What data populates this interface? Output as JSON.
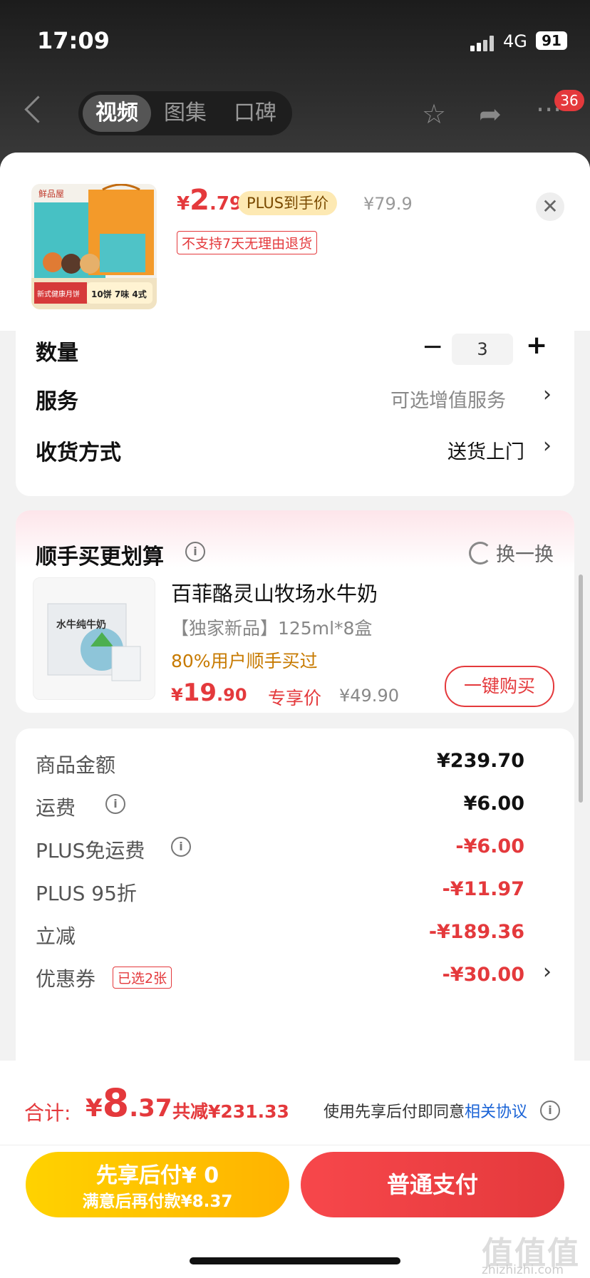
{
  "status": {
    "time": "17:09",
    "network": "4G",
    "battery": "91"
  },
  "nav": {
    "tabs": [
      "视频",
      "图集",
      "口碑"
    ],
    "badge": "36"
  },
  "product": {
    "price_yen": "¥",
    "price_int": "2",
    "price_dec": ".79",
    "plus_tag": "PLUS到手价",
    "original_price": "¥79.9",
    "no_return": "不支持7天无理由退货",
    "thumb_brand": "鲜品屋",
    "thumb_label": "新式健康月饼",
    "thumb_badge": "10饼 7味 4式"
  },
  "options": {
    "quantity_label": "数量",
    "quantity_value": "3",
    "service_label": "服务",
    "service_value": "可选增值服务",
    "delivery_label": "收货方式",
    "delivery_value": "送货上门"
  },
  "recommend": {
    "title": "顺手买更划算",
    "swap_label": "换一换",
    "name": "百菲酪灵山牧场水牛奶",
    "spec": "【独家新品】125ml*8盒",
    "buyers": "80%用户顺手买过",
    "price_yen": "¥",
    "price_int": "19",
    "price_dec": ".90",
    "price_tag": "专享价",
    "original_price": "¥49.90",
    "buy_label": "一键购买",
    "thumb_text": "水牛纯牛奶"
  },
  "fees": {
    "goods_label": "商品金额",
    "goods_value": "¥239.70",
    "shipping_label": "运费",
    "shipping_value": "¥6.00",
    "plus_free_label": "PLUS免运费",
    "plus_free_value": "-¥6.00",
    "plus_discount_label": "PLUS 95折",
    "plus_discount_value": "-¥11.97",
    "instant_label": "立减",
    "instant_value": "-¥189.36",
    "coupon_label": "优惠券",
    "coupon_tag": "已选2张",
    "coupon_value": "-¥30.00"
  },
  "footer": {
    "total_label": "合计:",
    "total_yen": "¥",
    "total_int": "8",
    "total_dec": ".37",
    "saved": "共减¥231.33",
    "agree_text": "使用先享后付即同意",
    "agree_link": "相关协议",
    "later_line1": "先享后付¥ 0",
    "later_line2": "满意后再付款¥8.37",
    "pay_label": "普通支付",
    "watermark": "值值值",
    "watermark_url": "zhizhizhi.com"
  },
  "colors": {
    "accent": "#e4393c",
    "gold": "#ffc400",
    "orange_text": "#c77a00"
  }
}
